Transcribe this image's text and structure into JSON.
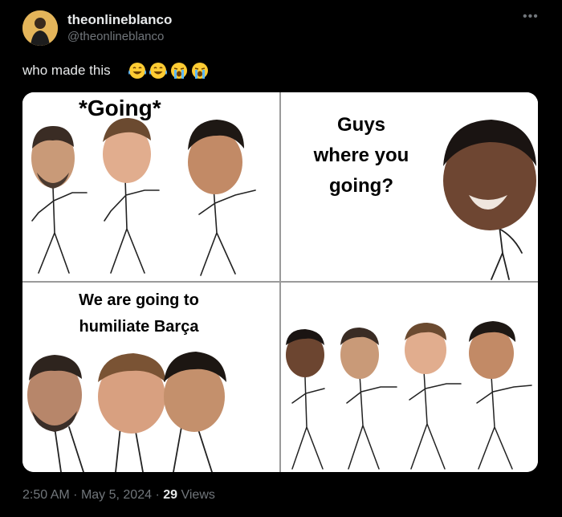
{
  "author": {
    "display_name": "theonlineblanco",
    "handle": "@theonlineblanco"
  },
  "tweet": {
    "text": "who made this",
    "emojis": [
      "tears-of-joy-emoji",
      "tears-of-joy-emoji",
      "loudly-crying-emoji",
      "loudly-crying-emoji"
    ]
  },
  "meme": {
    "panel1_caption": "*Going*",
    "panel2_caption": [
      "Guys",
      "where you",
      "going?"
    ],
    "panel3_caption": [
      "We are going to",
      "humiliate Barça"
    ]
  },
  "meta": {
    "time": "2:50 AM",
    "separator": "·",
    "date": "May 5, 2024",
    "views_count": "29",
    "views_label": "Views"
  },
  "colors": {
    "background": "#000000",
    "text_primary": "#e7e9ea",
    "text_secondary": "#71767b"
  }
}
